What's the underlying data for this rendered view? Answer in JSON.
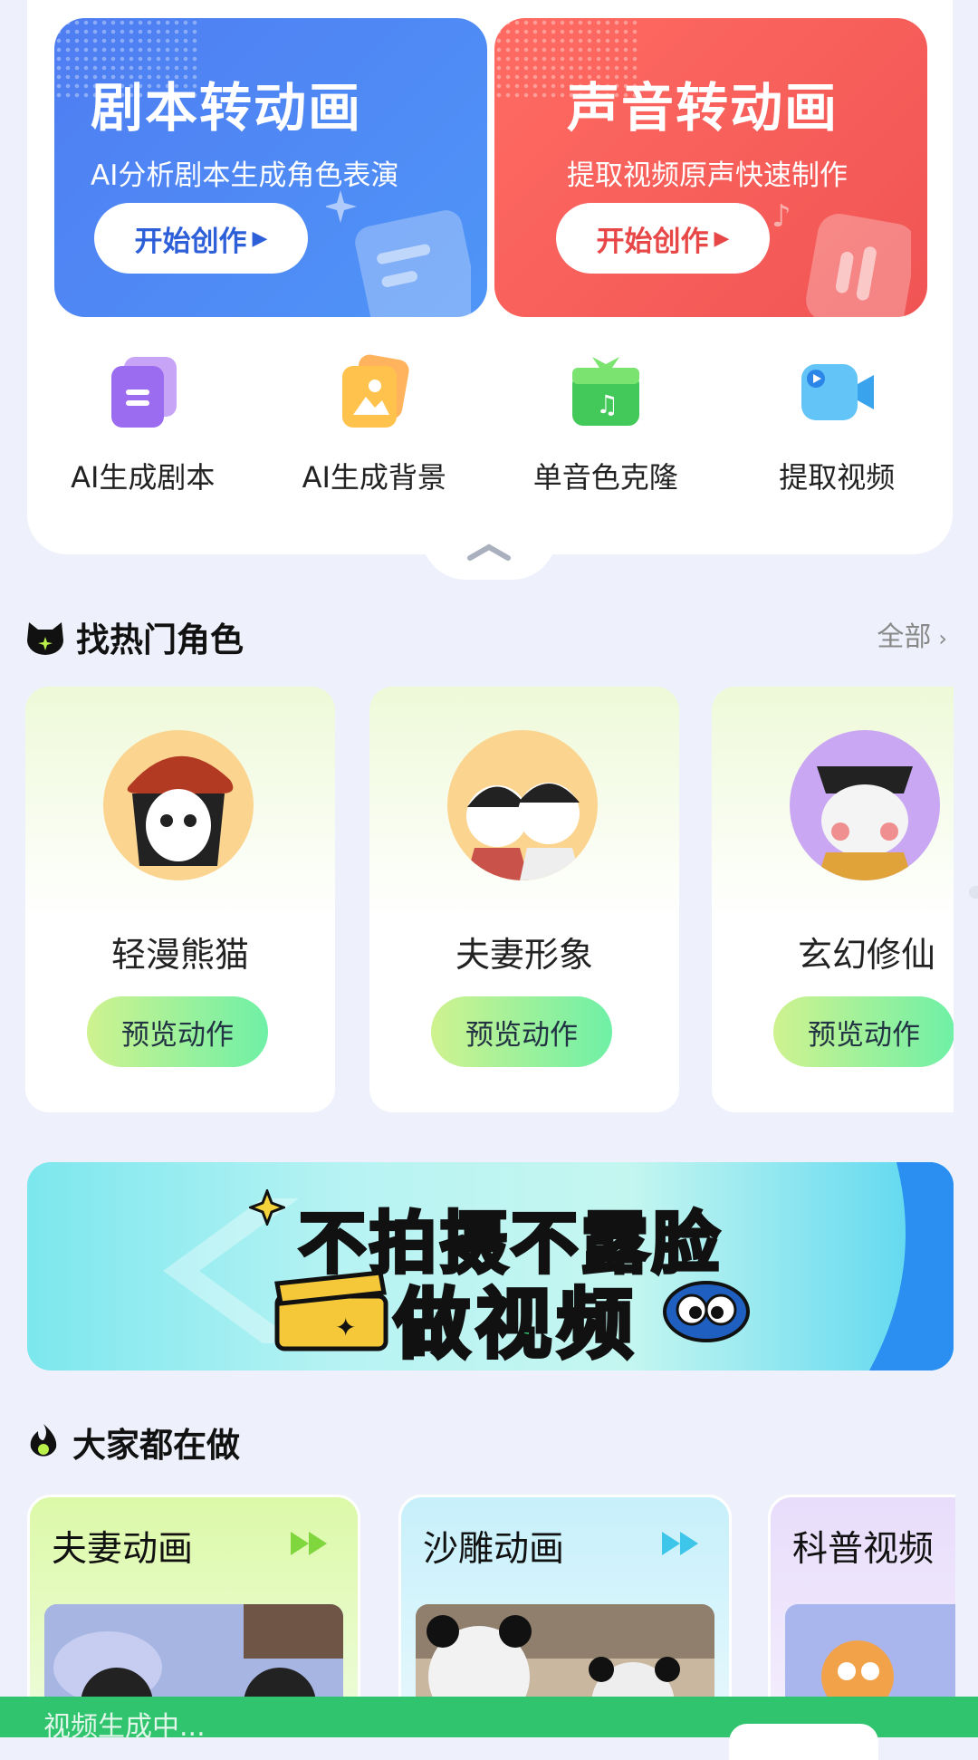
{
  "banners": [
    {
      "title": "剧本转动画",
      "subtitle": "AI分析剧本生成角色表演",
      "button": "开始创作"
    },
    {
      "title": "声音转动画",
      "subtitle": "提取视频原声快速制作",
      "button": "开始创作"
    }
  ],
  "tools": [
    {
      "label": "AI生成剧本",
      "icon": "script-icon"
    },
    {
      "label": "AI生成背景",
      "icon": "image-icon"
    },
    {
      "label": "单音色克隆",
      "icon": "music-gift-icon"
    },
    {
      "label": "提取视频",
      "icon": "video-camera-icon"
    }
  ],
  "roles_section": {
    "title": "找热门角色",
    "all_link": "全部"
  },
  "roles": [
    {
      "name": "轻漫熊猫",
      "button": "预览动作"
    },
    {
      "name": "夫妻形象",
      "button": "预览动作"
    },
    {
      "name": "玄幻修仙",
      "button": "预览动作"
    }
  ],
  "ad_banner": {
    "line1": "不拍摄不露脸",
    "line2": "做视频"
  },
  "works_section": {
    "title": "大家都在做"
  },
  "works": [
    {
      "title": "夫妻动画"
    },
    {
      "title": "沙雕动画"
    },
    {
      "title": "科普视频"
    }
  ],
  "bottom_bar": {
    "text": "视频生成中..."
  },
  "colors": {
    "accent_green": "#2fc46d",
    "banner_blue": "#4f7df2",
    "banner_red": "#f05454"
  }
}
